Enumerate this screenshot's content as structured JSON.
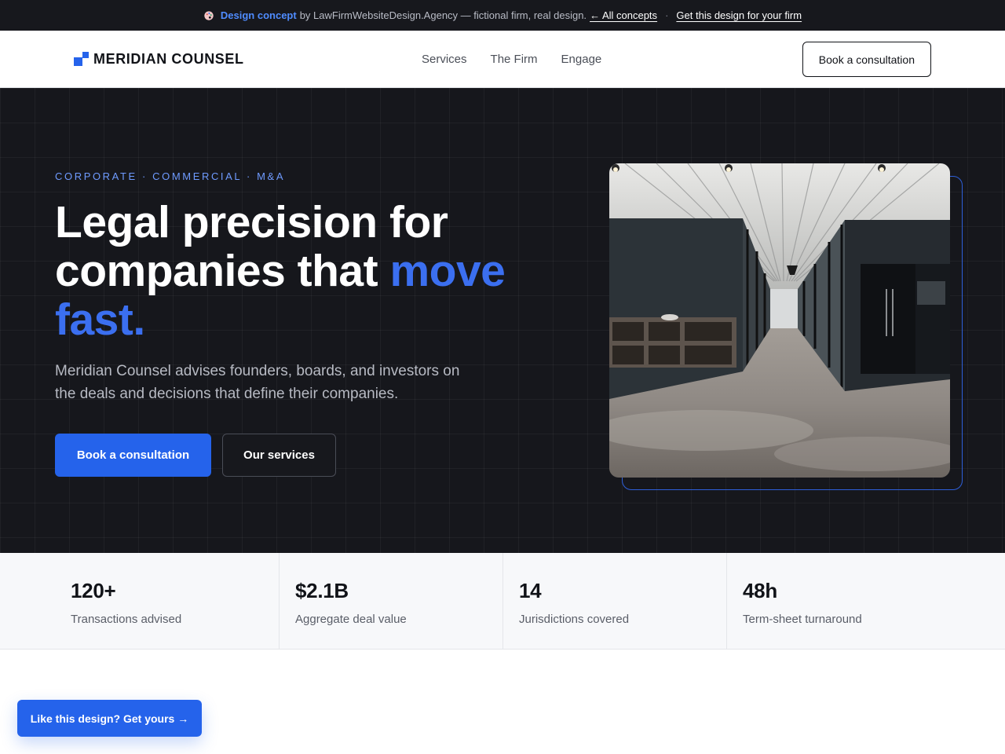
{
  "banner": {
    "icon": "palette-icon",
    "highlight": "Design concept",
    "text": "by LawFirmWebsiteDesign.Agency — fictional firm, real design.",
    "back_link": "← All concepts",
    "separator": "·",
    "cta_link": "Get this design for your firm"
  },
  "nav": {
    "logo": "MERIDIAN COUNSEL",
    "links": [
      "Services",
      "The Firm",
      "Engage"
    ],
    "cta": "Book a consultation"
  },
  "hero": {
    "eyebrow": "CORPORATE · COMMERCIAL · M&A",
    "headline_line1": "Legal precision for",
    "headline_line2": "companies that ",
    "headline_accent": "move fast.",
    "lede": "Meridian Counsel advises founders, boards, and investors on the deals and decisions that define their companies.",
    "primary_button": "Book a consultation",
    "secondary_button": "Our services",
    "image_subject": "office corridor photo"
  },
  "stats": [
    {
      "value": "120+",
      "label": "Transactions advised"
    },
    {
      "value": "$2.1B",
      "label": "Aggregate deal value"
    },
    {
      "value": "14",
      "label": "Jurisdictions covered"
    },
    {
      "value": "48h",
      "label": "Term-sheet turnaround"
    }
  ],
  "floating_cta": "Like this design? Get yours →",
  "colors": {
    "accent": "#2563eb",
    "hero_bg": "#16171c",
    "banner_bg": "#17181d",
    "stats_bg": "#f7f8fa"
  }
}
